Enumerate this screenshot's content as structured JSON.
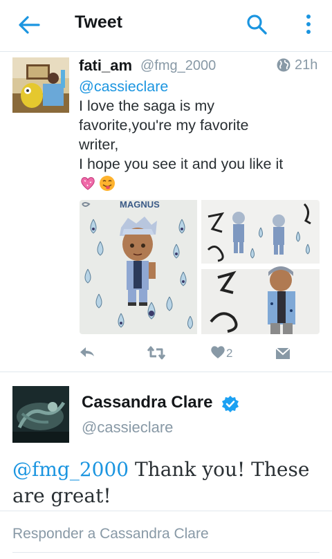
{
  "header": {
    "title": "Tweet"
  },
  "tweet": {
    "name": "fati_am",
    "handle": "@fmg_2000",
    "time": "21h",
    "mention": "@cassieclare",
    "lines": [
      "I love the saga is my",
      "favorite,you're my favorite",
      "writer,",
      "I hope you see it and you like it"
    ],
    "emojis": [
      "sparkling-heart",
      "smiling-face-with-tongue"
    ],
    "media_text": "MAGNUS",
    "like_count": "2"
  },
  "reply": {
    "name": "Cassandra Clare",
    "handle": "@cassieclare",
    "mention": "@fmg_2000",
    "text": " Thank you! These are great!"
  },
  "compose": {
    "placeholder": "Responder a Cassandra Clare"
  },
  "colors": {
    "accent": "#1b95e0",
    "muted": "#8899a6",
    "divider": "#e1e8ed"
  }
}
